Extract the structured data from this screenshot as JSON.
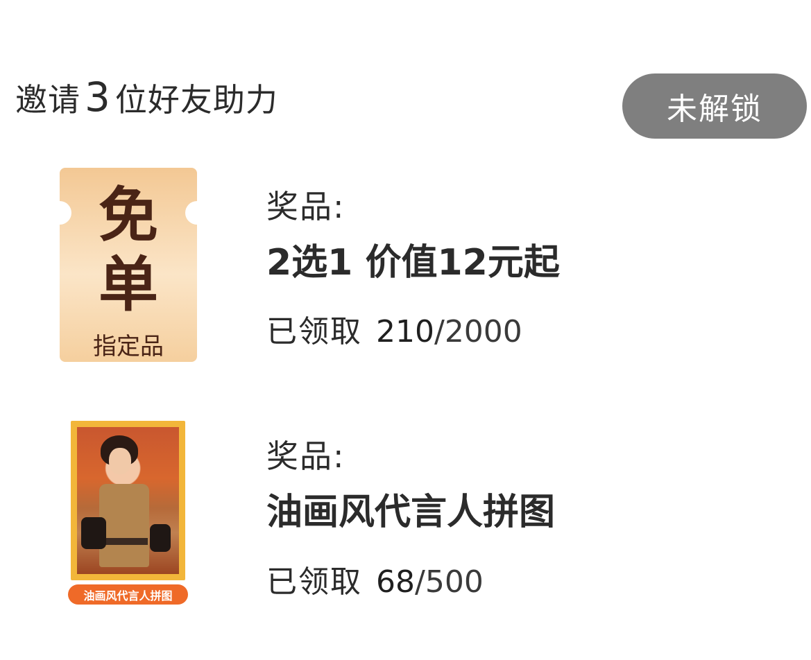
{
  "header": {
    "title_prefix": "邀请",
    "invite_count": "3",
    "title_suffix": "位好友助力",
    "status_label": "未解锁"
  },
  "prizes": [
    {
      "image": {
        "line1": "免",
        "line2": "单",
        "caption": "指定品",
        "colors": {
          "gold": "#f3c894",
          "ink": "#4a2416"
        }
      },
      "label": "奖品:",
      "name": "2选1 价值12元起",
      "claimed_label": "已领取",
      "claimed_count": "210",
      "separator": "/",
      "total": "2000"
    },
    {
      "image": {
        "tag": "油画风代言人拼图",
        "colors": {
          "frame": "#f2b63a",
          "tag": "#ef6a28"
        }
      },
      "label": "奖品:",
      "name": "油画风代言人拼图",
      "claimed_label": "已领取",
      "claimed_count": "68",
      "separator": "/",
      "total": "500"
    }
  ]
}
